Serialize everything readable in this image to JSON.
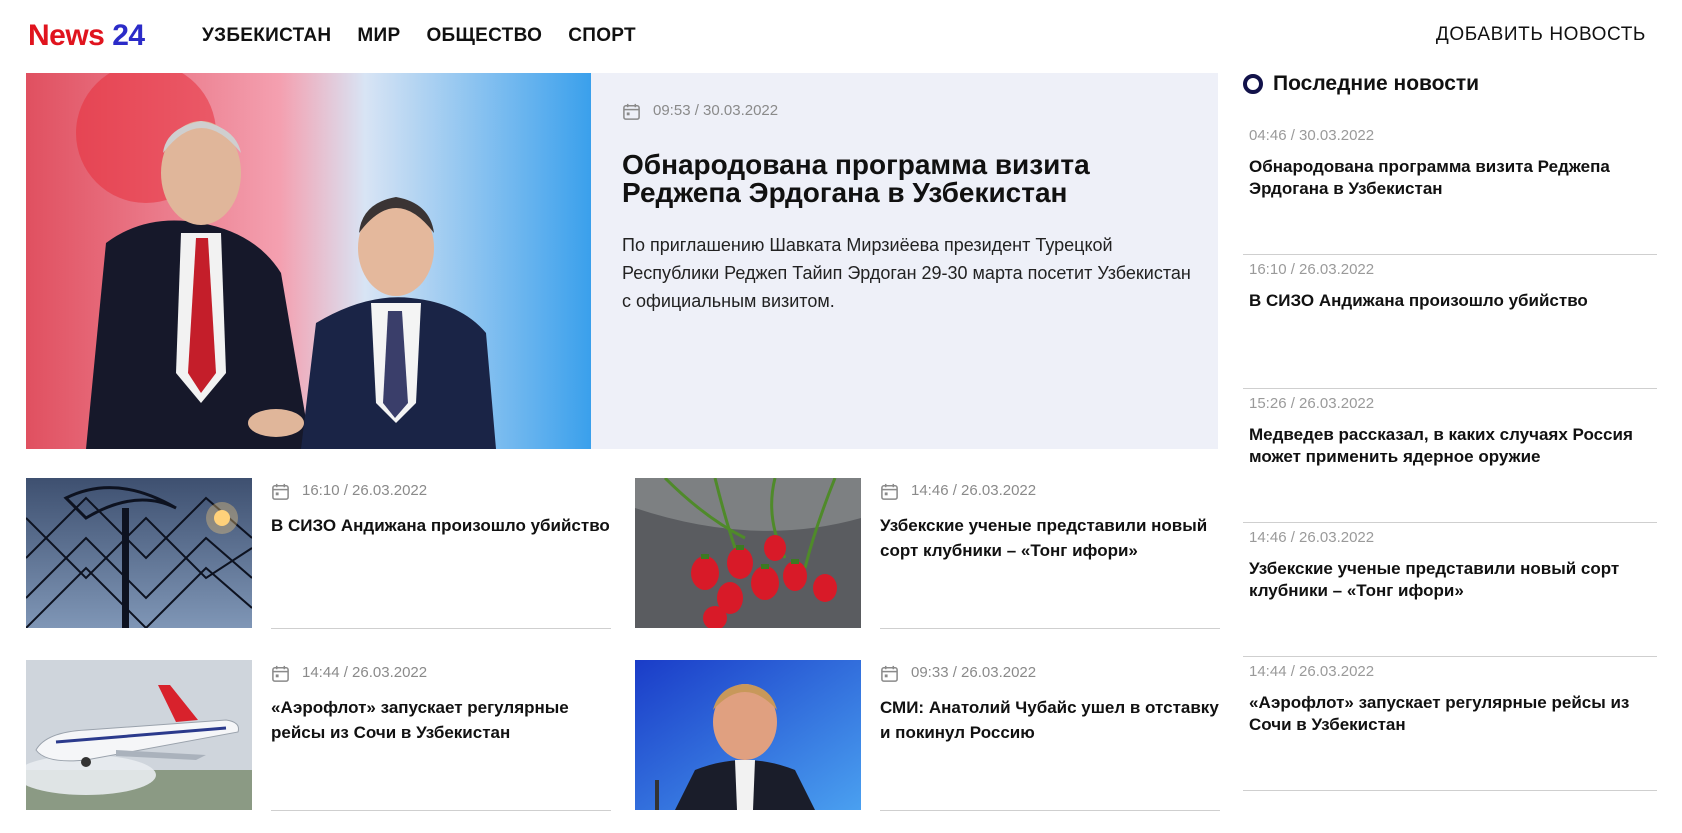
{
  "header": {
    "logo_part1": "News",
    "logo_part2": "24",
    "nav": [
      "УЗБЕКИСТАН",
      "МИР",
      "ОБЩЕСТВО",
      "СПОРТ"
    ],
    "add_news": "ДОБАВИТЬ НОВОСТЬ"
  },
  "hero": {
    "date": "09:53 / 30.03.2022",
    "title": "Обнародована программа визита Реджепа Эрдогана в Узбекистан",
    "lead": "По приглашению Шавката Мирзиёева президент Турецкой Республики Реджеп Тайип Эрдоган 29-30 марта посетит Узбекистан с официальным визитом."
  },
  "cards": [
    {
      "date": "16:10 / 26.03.2022",
      "title": "В СИЗО Андижана произошло убийство"
    },
    {
      "date": "14:46 / 26.03.2022",
      "title": "Узбекские ученые представили новый сорт клубники – «Тонг ифори»"
    },
    {
      "date": "14:44 / 26.03.2022",
      "title": "«Аэрофлот» запускает регулярные рейсы из Сочи в Узбекистан"
    },
    {
      "date": "09:33 / 26.03.2022",
      "title": "СМИ: Анатолий Чубайс ушел в отставку и покинул Россию"
    }
  ],
  "sidebar": {
    "title": "Последние новости",
    "items": [
      {
        "date": "04:46 / 30.03.2022",
        "title": "Обнародована программа визита Реджепа Эрдогана в Узбекистан"
      },
      {
        "date": "16:10 / 26.03.2022",
        "title": "В СИЗО Андижана произошло убийство"
      },
      {
        "date": "15:26 / 26.03.2022",
        "title": "Медведев рассказал, в каких случаях Россия может применить ядерное оружие"
      },
      {
        "date": "14:46 / 26.03.2022",
        "title": "Узбекские ученые представили новый сорт клубники – «Тонг ифори»"
      },
      {
        "date": "14:44 / 26.03.2022",
        "title": "«Аэрофлот» запускает регулярные рейсы из Сочи в Узбекистан"
      }
    ]
  },
  "colors": {
    "logo_red": "#e0141e",
    "logo_blue": "#2b2bc8",
    "hero_bg": "#eef0f8",
    "date_grey": "#8a8a8a",
    "accent_navy": "#12124a"
  },
  "icons": [
    "calendar-icon",
    "ring-bullet-icon"
  ]
}
